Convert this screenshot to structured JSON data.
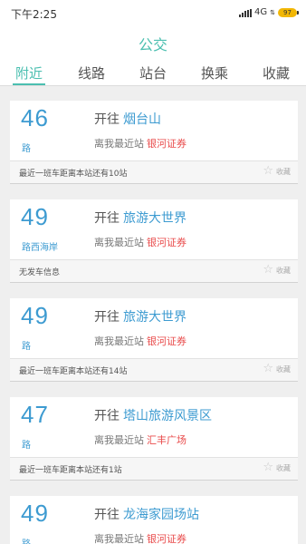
{
  "status": {
    "time": "下午2:25",
    "network": "4G",
    "battery": "97"
  },
  "header": {
    "title": "公交"
  },
  "tabs": [
    {
      "label": "附近",
      "active": true
    },
    {
      "label": "线路",
      "active": false
    },
    {
      "label": "站台",
      "active": false
    },
    {
      "label": "换乘",
      "active": false
    },
    {
      "label": "收藏",
      "active": false
    }
  ],
  "labels": {
    "direction_prefix": "开往",
    "nearest_prefix": "离我最近站",
    "favorite": "收藏"
  },
  "routes": [
    {
      "number": "46",
      "suffix": "路",
      "destination": "烟台山",
      "nearest_station": "银河证券",
      "info": "最近一班车距离本站还有10站"
    },
    {
      "number": "49",
      "suffix": "路西海岸",
      "destination": "旅游大世界",
      "nearest_station": "银河证券",
      "info": "无发车信息"
    },
    {
      "number": "49",
      "suffix": "路",
      "destination": "旅游大世界",
      "nearest_station": "银河证券",
      "info": "最近一班车距离本站还有14站"
    },
    {
      "number": "47",
      "suffix": "路",
      "destination": "塔山旅游风景区",
      "nearest_station": "汇丰广场",
      "info": "最近一班车距离本站还有1站"
    },
    {
      "number": "49",
      "suffix": "路",
      "destination": "龙海家园场站",
      "nearest_station": "银河证券",
      "info": ""
    }
  ]
}
